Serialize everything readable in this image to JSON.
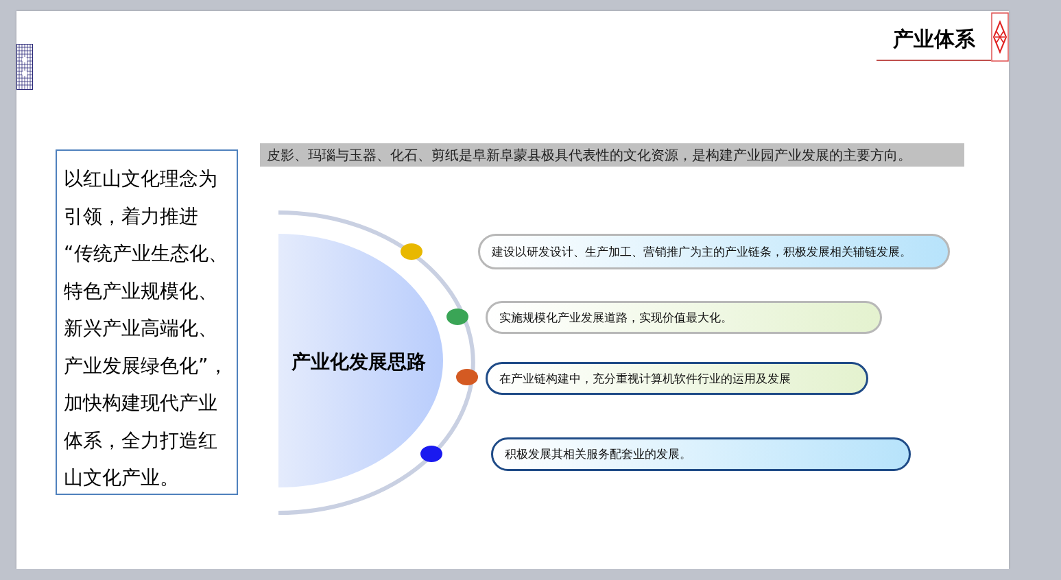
{
  "slide": {
    "title": "产业体系",
    "intro_lines": [
      "以红山文化理念为",
      "引领，着力推进",
      "“传统产业生态化、",
      "特色产业规模化、",
      "新兴产业高端化、",
      "产业发展绿色化”，",
      "加快构建现代产业",
      "体系，全力打造红",
      "山文化产业。"
    ],
    "banner": "皮影、玛瑙与玉器、化石、剪纸是阜新阜蒙县极具代表性的文化资源，是构建产业园产业发展的主要方向。",
    "hub": "产业化发展思路",
    "items": [
      {
        "text": "建设以研发设计、生产加工、营销推广为主的产业链条，积极发展相关辅链发展。",
        "color": "#e8b800"
      },
      {
        "text": "实施规模化产业发展道路，实现价值最大化。",
        "color": "#3aa556"
      },
      {
        "text": "在产业链构建中，充分重视计算机软件行业的运用及发展",
        "color": "#d45a22"
      },
      {
        "text": "积极发展其相关服务配套业的发展。",
        "color": "#1a1af0"
      }
    ]
  }
}
